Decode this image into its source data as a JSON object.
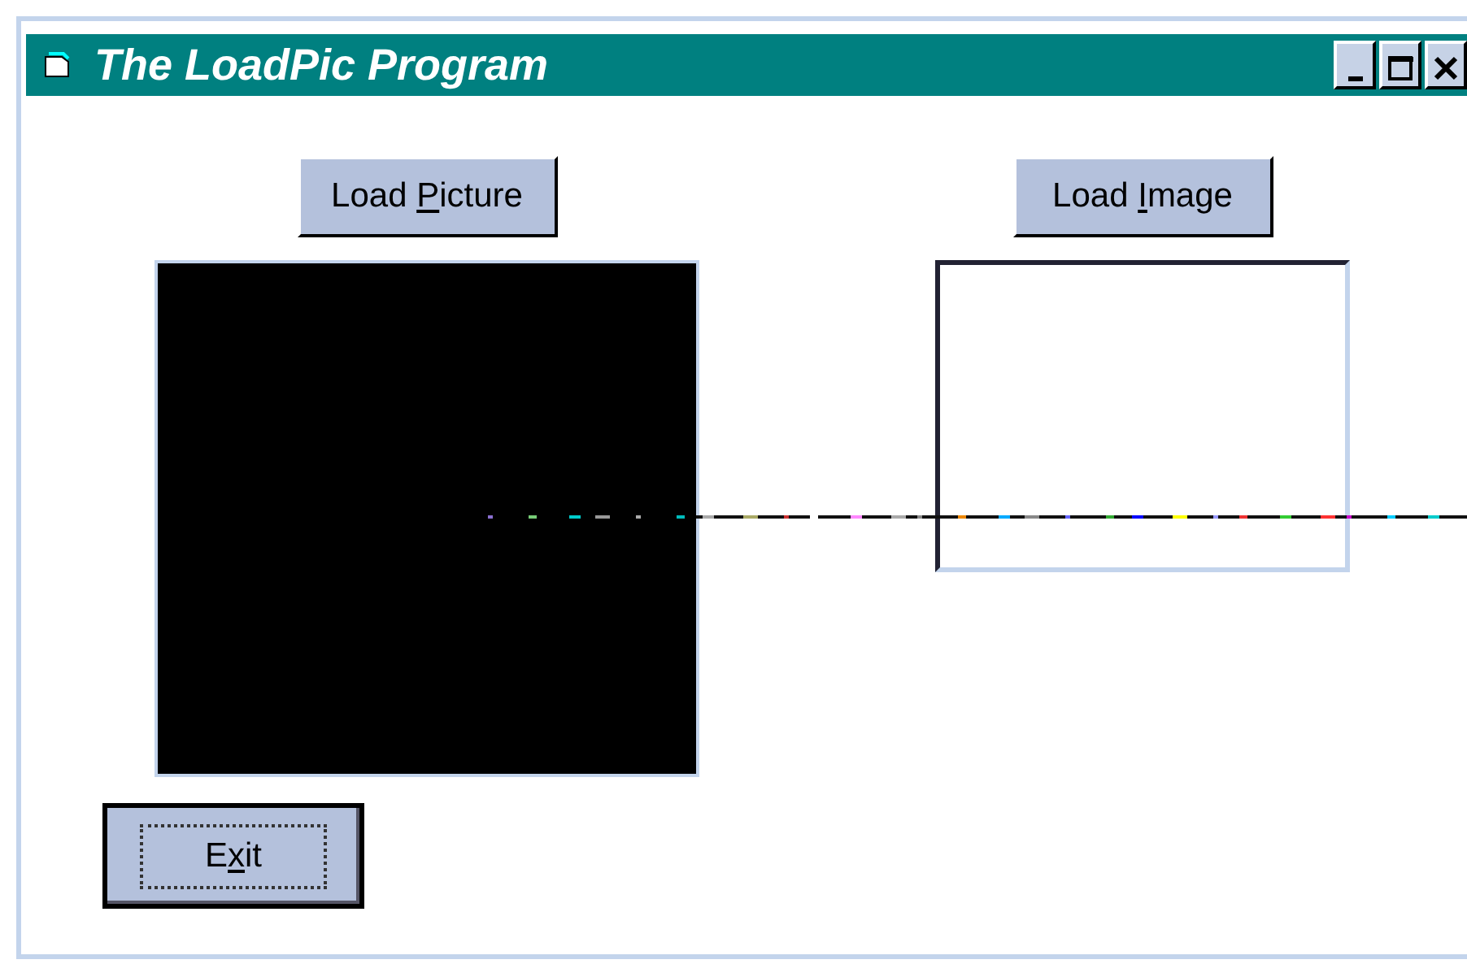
{
  "window": {
    "title": "The LoadPic Program"
  },
  "buttons": [
    {
      "before": "Load ",
      "key": "P",
      "after": "icture",
      "focused": false
    },
    {
      "before": "Load ",
      "key": "I",
      "after": "mage",
      "focused": false
    },
    {
      "before": "E",
      "key": "x",
      "after": "it",
      "focused": true
    }
  ]
}
